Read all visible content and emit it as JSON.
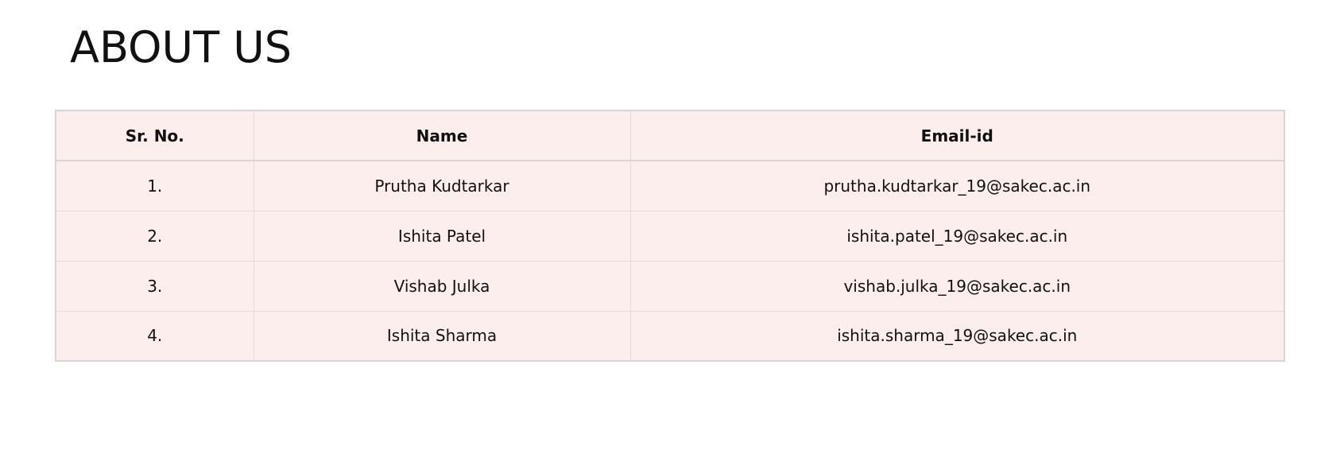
{
  "page": {
    "title": "ABOUT US"
  },
  "table": {
    "headers": [
      "Sr. No.",
      "Name",
      "Email-id"
    ],
    "rows": [
      {
        "sr": "1.",
        "name": "Prutha Kudtarkar",
        "email": "prutha.kudtarkar_19@sakec.ac.in"
      },
      {
        "sr": "2.",
        "name": "Ishita Patel",
        "email": "ishita.patel_19@sakec.ac.in"
      },
      {
        "sr": "3.",
        "name": "Vishab Julka",
        "email": "vishab.julka_19@sakec.ac.in"
      },
      {
        "sr": "4.",
        "name": "Ishita Sharma",
        "email": "ishita.sharma_19@sakec.ac.in"
      }
    ]
  },
  "colors": {
    "table_background": "#fbeeed",
    "border": "#d9d5d5",
    "text": "#111111"
  }
}
